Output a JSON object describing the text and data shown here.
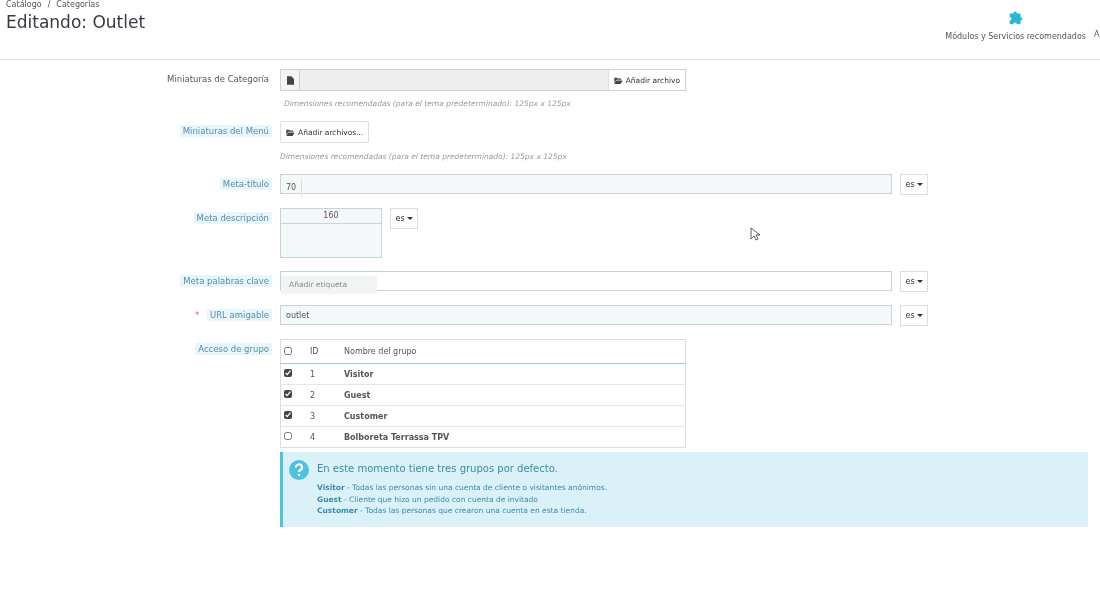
{
  "breadcrumb": {
    "separator": "/",
    "items": [
      "Catálogo",
      "Categorías"
    ]
  },
  "title": "Editando: Outlet",
  "toolbar": [
    {
      "label": "Módulos y Servicios recomendados",
      "kind": "puzzle"
    },
    {
      "label": "A",
      "kind": "cut"
    }
  ],
  "fields": [
    {
      "kind": "file",
      "label": "Miniaturas de Categoría",
      "hint": false,
      "button": "Añadir archivo",
      "help": "Dimensiones recomendadas (para el tema predeterminado): 125px x 125px"
    },
    {
      "kind": "files",
      "label": "Miniaturas del Menú",
      "hint": true,
      "button": "Añadir archivos...",
      "help": "Dimensiones recomendadas (para el tema predeterminado): 125px x 125px"
    },
    {
      "kind": "counter",
      "label": "Meta-título",
      "hint": true,
      "counter": "70",
      "lang": "es"
    },
    {
      "kind": "textarea",
      "label": "Meta descripción",
      "hint": true,
      "counter": "160",
      "lang": "es"
    },
    {
      "kind": "tags",
      "label": "Meta palabras clave",
      "hint": true,
      "placeholder": "Añadir etiqueta",
      "lang": "es"
    },
    {
      "kind": "text",
      "label": "URL amigable",
      "hint": true,
      "required_mark": "*",
      "value": "outlet",
      "lang": "es"
    },
    {
      "kind": "groups",
      "label": "Acceso de grupo",
      "hint": true
    }
  ],
  "groups": {
    "columns": [
      "ID",
      "Nombre del grupo"
    ],
    "all_checked": false,
    "rows": [
      {
        "id": "1",
        "name": "Visitor",
        "checked": true
      },
      {
        "id": "2",
        "name": "Guest",
        "checked": true
      },
      {
        "id": "3",
        "name": "Customer",
        "checked": true
      },
      {
        "id": "4",
        "name": "Bolboreta Terrassa TPV",
        "checked": false
      }
    ]
  },
  "alert": {
    "title": "En este momento tiene tres grupos por defecto.",
    "lines": [
      "**Visitor** - Todas las personas sin una cuenta de cliente o visitantes anónimos.",
      "**Guest** - Cliente que hizo un pedido con cuenta de invitado",
      "**Customer** - Todas las personas que crearon una cuenta en esta tienda."
    ]
  }
}
